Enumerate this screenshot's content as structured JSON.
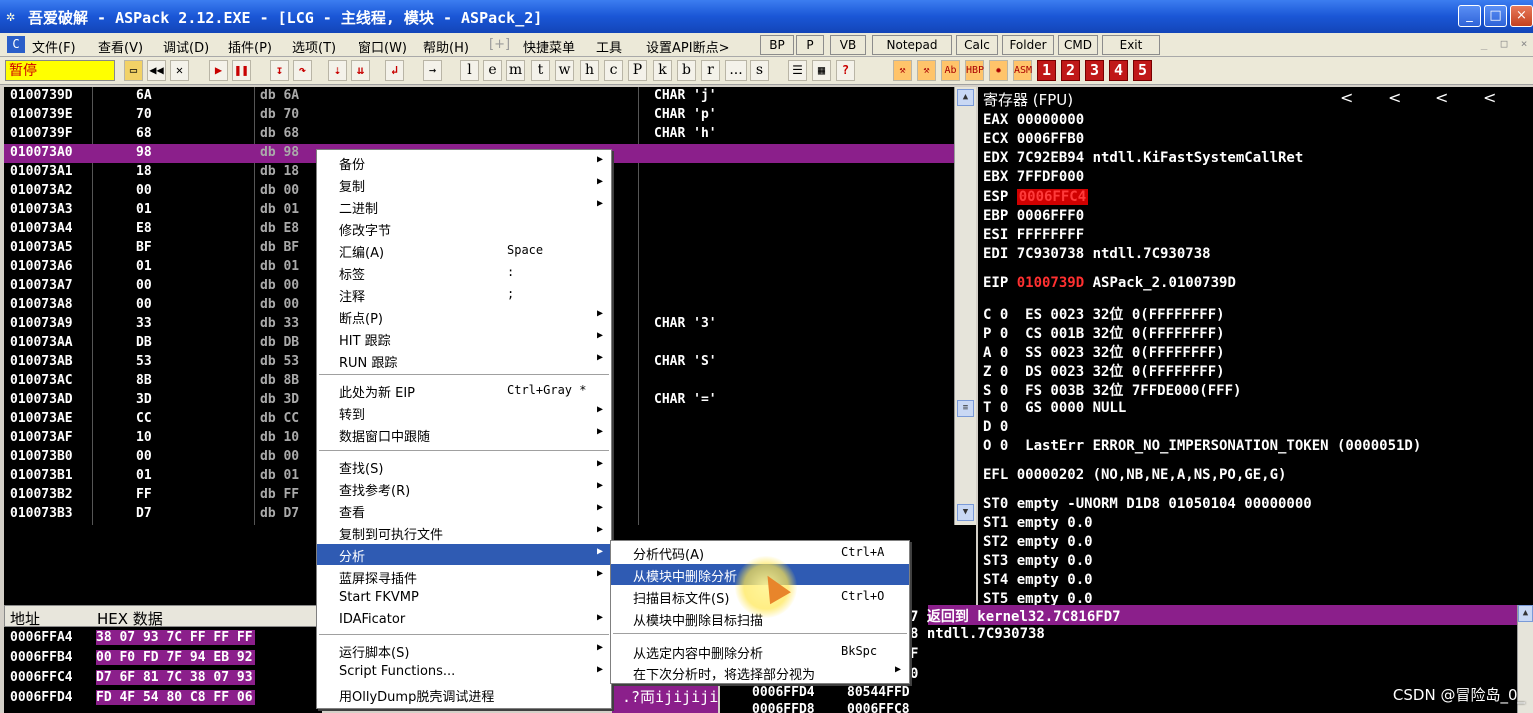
{
  "window": {
    "title": "吾爱破解 - ASPack 2.12.EXE - [LCG - 主线程, 模块 - ASPack_2]",
    "app_icon": "bug-icon",
    "minimize": "_",
    "maximize": "□",
    "close": "×"
  },
  "menubar": {
    "items": [
      "文件(F)",
      "查看(V)",
      "调试(D)",
      "插件(P)",
      "选项(T)",
      "窗口(W)",
      "帮助(H)",
      "[+]",
      "快捷菜单",
      "工具",
      "设置API断点>"
    ],
    "buttons": [
      "BP",
      "P",
      "VB",
      "Notepad",
      "Calc",
      "Folder",
      "CMD",
      "Exit"
    ],
    "mdi": [
      "_",
      "□",
      "×"
    ]
  },
  "toolbar": {
    "status": "暂停",
    "nav_icons": [
      "open-icon",
      "rewind-icon",
      "close-icon",
      "run-icon",
      "pause-icon",
      "step-into-icon",
      "step-over-icon",
      "trace-into-icon",
      "trace-over-icon",
      "execute-till-return-icon",
      "goto-icon"
    ],
    "letters": [
      "l",
      "e",
      "m",
      "t",
      "w",
      "h",
      "c",
      "P",
      "k",
      "b",
      "r",
      "...",
      "s"
    ],
    "numbers": [
      "1",
      "2",
      "3",
      "4",
      "5"
    ],
    "plugin_labels": [
      "Ab",
      "HBP",
      "ASM"
    ]
  },
  "disasm": {
    "rows": [
      {
        "addr": "0100739D",
        "hex": "6A",
        "cmd": "db 6A",
        "cmt": "CHAR 'j'"
      },
      {
        "addr": "0100739E",
        "hex": "70",
        "cmd": "db 70",
        "cmt": "CHAR 'p'"
      },
      {
        "addr": "0100739F",
        "hex": "68",
        "cmd": "db 68",
        "cmt": "CHAR 'h'"
      },
      {
        "addr": "010073A0",
        "hex": "98",
        "cmd": "db 98",
        "cmt": ""
      },
      {
        "addr": "010073A1",
        "hex": "18",
        "cmd": "db 18",
        "cmt": ""
      },
      {
        "addr": "010073A2",
        "hex": "00",
        "cmd": "db 00",
        "cmt": ""
      },
      {
        "addr": "010073A3",
        "hex": "01",
        "cmd": "db 01",
        "cmt": ""
      },
      {
        "addr": "010073A4",
        "hex": "E8",
        "cmd": "db E8",
        "cmt": ""
      },
      {
        "addr": "010073A5",
        "hex": "BF",
        "cmd": "db BF",
        "cmt": ""
      },
      {
        "addr": "010073A6",
        "hex": "01",
        "cmd": "db 01",
        "cmt": ""
      },
      {
        "addr": "010073A7",
        "hex": "00",
        "cmd": "db 00",
        "cmt": ""
      },
      {
        "addr": "010073A8",
        "hex": "00",
        "cmd": "db 00",
        "cmt": ""
      },
      {
        "addr": "010073A9",
        "hex": "33",
        "cmd": "db 33",
        "cmt": "CHAR '3'"
      },
      {
        "addr": "010073AA",
        "hex": "DB",
        "cmd": "db DB",
        "cmt": ""
      },
      {
        "addr": "010073AB",
        "hex": "53",
        "cmd": "db 53",
        "cmt": "CHAR 'S'"
      },
      {
        "addr": "010073AC",
        "hex": "8B",
        "cmd": "db 8B",
        "cmt": ""
      },
      {
        "addr": "010073AD",
        "hex": "3D",
        "cmd": "db 3D",
        "cmt": "CHAR '='"
      },
      {
        "addr": "010073AE",
        "hex": "CC",
        "cmd": "db CC",
        "cmt": ""
      },
      {
        "addr": "010073AF",
        "hex": "10",
        "cmd": "db 10",
        "cmt": ""
      },
      {
        "addr": "010073B0",
        "hex": "00",
        "cmd": "db 00",
        "cmt": ""
      },
      {
        "addr": "010073B1",
        "hex": "01",
        "cmd": "db 01",
        "cmt": ""
      },
      {
        "addr": "010073B2",
        "hex": "FF",
        "cmd": "db FF",
        "cmt": ""
      },
      {
        "addr": "010073B3",
        "hex": "D7",
        "cmd": "db D7",
        "cmt": ""
      }
    ],
    "selected_index": 3
  },
  "registers": {
    "header": "寄存器 (FPU)",
    "arrows": [
      "<",
      "<",
      "<",
      "<"
    ],
    "lines": [
      "EAX 00000000",
      "ECX 0006FFB0",
      "EDX 7C92EB94 ntdll.KiFastSystemCallRet",
      "EBX 7FFDF000"
    ],
    "esp_label": "ESP ",
    "esp_value": "0006FFC4",
    "lines2": [
      "EBP 0006FFF0",
      "ESI FFFFFFFF",
      "EDI 7C930738 ntdll.7C930738"
    ],
    "eip_label": "EIP ",
    "eip_value": "0100739D",
    "eip_rest": " ASPack_2.0100739D",
    "flags": [
      "C 0  ES 0023 32位 0(FFFFFFFF)",
      "P 0  CS 001B 32位 0(FFFFFFFF)",
      "A 0  SS 0023 32位 0(FFFFFFFF)",
      "Z 0  DS 0023 32位 0(FFFFFFFF)",
      "S 0  FS 003B 32位 7FFDE000(FFF)",
      "T 0  GS 0000 NULL",
      "D 0",
      "O 0  LastErr ERROR_NO_IMPERSONATION_TOKEN (0000051D)"
    ],
    "efl": "EFL 00000202 (NO,NB,NE,A,NS,PO,GE,G)",
    "fpu": [
      "ST0 empty -UNORM D1D8 01050104 00000000",
      "ST1 empty 0.0",
      "ST2 empty 0.0",
      "ST3 empty 0.0",
      "ST4 empty 0.0",
      "ST5 empty 0.0"
    ]
  },
  "dump": {
    "col_addr": "地址",
    "col_hex": "HEX 数据",
    "rows": [
      {
        "addr": "0006FFA4",
        "hex": "38 07 93 7C FF FF FF"
      },
      {
        "addr": "0006FFB4",
        "hex": "00 F0 FD 7F 94 EB 92"
      },
      {
        "addr": "0006FFC4",
        "hex": "D7 6F 81 7C 38 07 93"
      },
      {
        "addr": "0006FFD4",
        "hex": "FD 4F 54 80 C8 FF 06"
      }
    ]
  },
  "stack": {
    "top_line": "7 返回到 kernel32.7C816FD7",
    "line2": "8 ntdll.7C930738",
    "line3": "F",
    "line4": "0",
    "snippet": ".?両ijijiji",
    "row_addr": "0006FFD4",
    "row_val": "80544FFD",
    "row_addr2": "0006FFD8",
    "row_val2": "0006FFC8"
  },
  "context_menu": {
    "items": [
      {
        "label": "备份",
        "key": "",
        "sub": true
      },
      {
        "label": "复制",
        "key": "",
        "sub": true
      },
      {
        "label": "二进制",
        "key": "",
        "sub": true
      },
      {
        "label": "修改字节",
        "key": "",
        "sub": false
      },
      {
        "label": "汇编(A)",
        "key": "Space",
        "sub": false
      },
      {
        "label": "标签",
        "key": ":",
        "sub": false
      },
      {
        "label": "注释",
        "key": ";",
        "sub": false
      },
      {
        "label": "断点(P)",
        "key": "",
        "sub": true
      },
      {
        "label": "HIT 跟踪",
        "key": "",
        "sub": true
      },
      {
        "label": "RUN 跟踪",
        "key": "",
        "sub": true
      },
      {
        "label": "此处为新 EIP",
        "key": "Ctrl+Gray *",
        "sub": false
      },
      {
        "label": "转到",
        "key": "",
        "sub": true
      },
      {
        "label": "数据窗口中跟随",
        "key": "",
        "sub": true
      },
      {
        "label": "查找(S)",
        "key": "",
        "sub": true
      },
      {
        "label": "查找参考(R)",
        "key": "",
        "sub": true
      },
      {
        "label": "查看",
        "key": "",
        "sub": true
      },
      {
        "label": "复制到可执行文件",
        "key": "",
        "sub": true
      },
      {
        "label": "分析",
        "key": "",
        "sub": true
      },
      {
        "label": "蓝屏探寻插件",
        "key": "",
        "sub": true
      },
      {
        "label": "Start FKVMP",
        "key": "",
        "sub": false
      },
      {
        "label": "IDAFicator",
        "key": "",
        "sub": true
      },
      {
        "label": "运行脚本(S)",
        "key": "",
        "sub": true
      },
      {
        "label": "Script Functions...",
        "key": "",
        "sub": true
      },
      {
        "label": "用OllyDump脱壳调试进程",
        "key": "",
        "sub": false
      }
    ]
  },
  "submenu": {
    "items": [
      {
        "label": "分析代码(A)",
        "key": "Ctrl+A"
      },
      {
        "label": "从模块中删除分析",
        "key": ""
      },
      {
        "label": "扫描目标文件(S)",
        "key": "Ctrl+O"
      },
      {
        "label": "从模块中删除目标扫描",
        "key": ""
      },
      {
        "label": "从选定内容中删除分析",
        "key": "BkSpc"
      },
      {
        "label": "在下次分析时，将选择部分视为",
        "key": ""
      }
    ]
  },
  "watermark": "CSDN @冒险岛_0_"
}
